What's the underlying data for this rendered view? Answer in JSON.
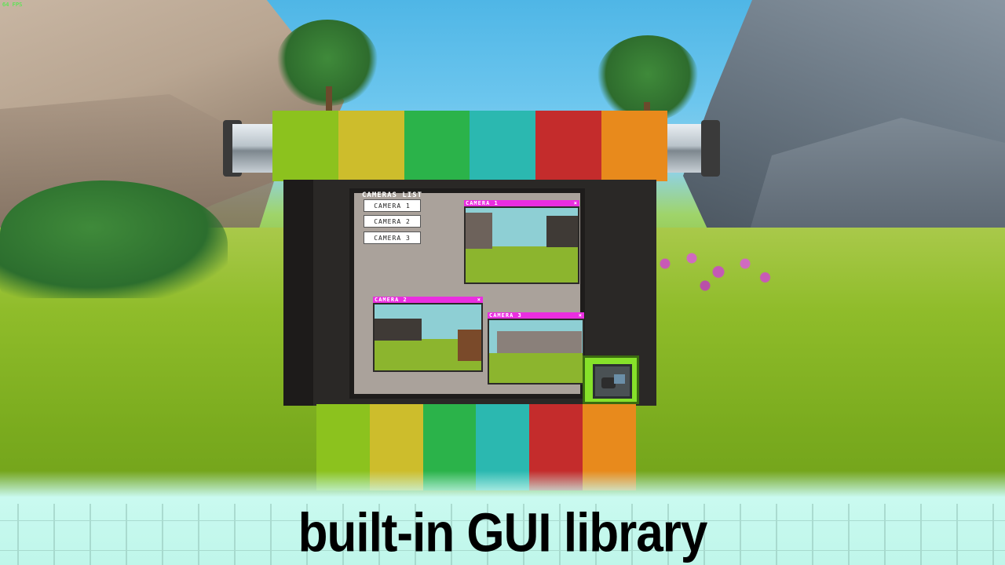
{
  "hud": {
    "fps": "64 FPS"
  },
  "gui": {
    "list_title": "CAMERAS LIST",
    "buttons": [
      "CAMERA 1",
      "CAMERA 2",
      "CAMERA 3"
    ],
    "windows": [
      {
        "title": "CAMERA 1",
        "close": "×"
      },
      {
        "title": "CAMERA 2",
        "close": "×"
      },
      {
        "title": "CAMERA 3",
        "close": "×"
      }
    ],
    "window_bar_color": "#ea2ee0"
  },
  "frame_colors": [
    "#8cc21e",
    "#cdbd2c",
    "#2bb34a",
    "#2bb8b0",
    "#c42c2c",
    "#e88a1c"
  ],
  "caption": "built-in GUI library"
}
